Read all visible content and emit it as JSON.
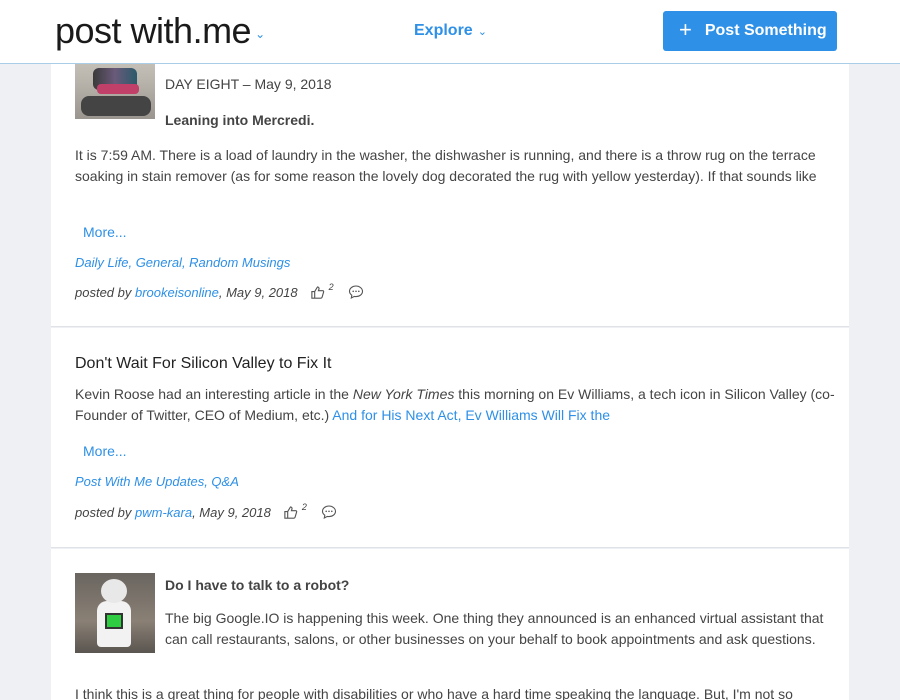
{
  "header": {
    "logo_text": "post with.me",
    "explore_label": "Explore",
    "post_button_label": "Post Something"
  },
  "posts": [
    {
      "day_line": "DAY EIGHT – May 9, 2018",
      "subtitle": "Leaning into Mercredi.",
      "excerpt": "It is 7:59 AM. There is a load of laundry in the washer, the dishwasher is running, and there is a throw rug on the terrace soaking in stain remover (as for some reason the lovely dog decorated the rug with yellow yesterday). If that sounds like",
      "more_label": "More...",
      "categories": "Daily Life, General, Random Musings",
      "posted_by_label": "posted by",
      "author": "brookeisonline",
      "date": ", May 9, 2018",
      "likes": "2"
    },
    {
      "title": "Don't Wait For Silicon Valley to Fix It",
      "excerpt_before": "Kevin Roose had an interesting article in the ",
      "excerpt_italic": "New York Times",
      "excerpt_middle": " this morning on Ev Williams, a tech icon in Silicon Valley (co-Founder of Twitter, CEO of Medium, etc.) ",
      "excerpt_link": "And for His Next Act, Ev Williams Will Fix the",
      "more_label": "More...",
      "categories": "Post With Me Updates, Q&A",
      "posted_by_label": "posted by",
      "author": "pwm-kara",
      "date": ", May 9, 2018",
      "likes": "2"
    },
    {
      "title": "Do I have to talk to a robot?",
      "excerpt": "The big Google.IO is happening this week. One thing they announced is an enhanced virtual assistant that can call restaurants, salons, or other businesses on your behalf to book appointments and ask questions.",
      "excerpt_2": "I think this is a great thing for people with disabilities or who have a hard time speaking the language. But, I'm not so"
    }
  ]
}
